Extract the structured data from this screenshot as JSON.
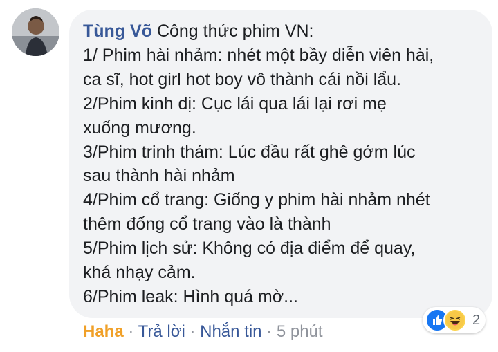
{
  "comment": {
    "author": "Tùng Võ",
    "lines": [
      "Công thức phim VN:",
      "1/ Phim hài nhảm: nhét một bầy diễn viên hài,",
      "ca sĩ, hot girl hot boy vô thành cái nồi lẩu.",
      "2/Phim kinh dị: Cục lái qua lái lại rơi mẹ",
      "xuống mương.",
      "3/Phim trinh thám: Lúc đầu rất ghê gớm lúc",
      "sau thành hài nhảm",
      "4/Phim cổ trang: Giống y phim hài nhảm nhét",
      "thêm đống cổ trang vào là thành",
      "5/Phim lịch sử: Không có địa điểm để quay,",
      "khá nhạy cảm.",
      "6/Phim leak: Hình quá mờ..."
    ]
  },
  "reactions": {
    "icons": [
      "like-icon",
      "haha-icon"
    ],
    "count": "2"
  },
  "actions": {
    "reaction_label": "Haha",
    "reply_label": "Trả lời",
    "message_label": "Nhắn tin",
    "separator": " · ",
    "time": "5 phút"
  },
  "colors": {
    "author": "#385898",
    "haha": "#f0a028",
    "bubble": "#f2f3f5",
    "like": "#1877f2"
  }
}
